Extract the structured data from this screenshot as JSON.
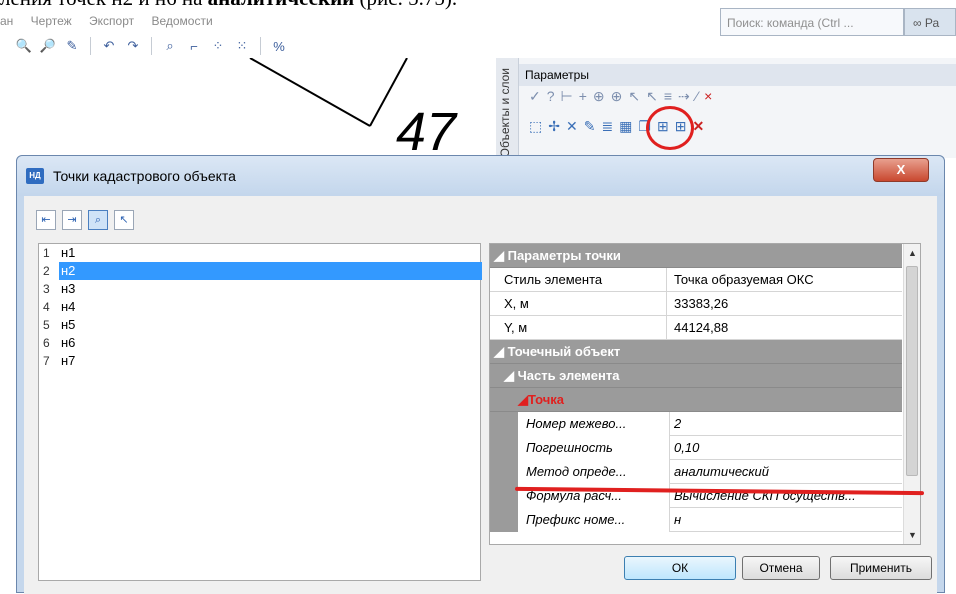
{
  "caption": {
    "pre": "ления точек н2 и н6 на ",
    "bold": "аналитический",
    "post": " (рис. 5.75)."
  },
  "menu": [
    "ан",
    "Чертеж",
    "Экспорт",
    "Ведомости"
  ],
  "search": {
    "placeholder": "Поиск: команда (Ctrl ...",
    "right_label": "Ра"
  },
  "drawing": {
    "number_label": "47"
  },
  "panel": {
    "vertical_tab": "Объекты и слои",
    "title": "Параметры"
  },
  "dialog": {
    "title": "Точки кадастрового объекта",
    "icon_text": "НД",
    "close": "X",
    "points": [
      {
        "num": "1",
        "label": "н1"
      },
      {
        "num": "2",
        "label": "н2"
      },
      {
        "num": "3",
        "label": "н3"
      },
      {
        "num": "4",
        "label": "н4"
      },
      {
        "num": "5",
        "label": "н5"
      },
      {
        "num": "6",
        "label": "н6"
      },
      {
        "num": "7",
        "label": "н7"
      }
    ],
    "selected_index": 1,
    "props": {
      "cat1": "Параметры точки",
      "style_key": "Стиль элемента",
      "style_val": "Точка образуемая ОКС",
      "x_key": "X, м",
      "x_val": "33383,26",
      "y_key": "Y, м",
      "y_val": "44124,88",
      "cat2": "Точечный объект",
      "cat3": "Часть элемента",
      "cat4": "Точка",
      "num_key": "Номер межево...",
      "num_val": "2",
      "err_key": "Погрешность",
      "err_val": "0,10",
      "method_key": "Метод опреде...",
      "method_val": "аналитический",
      "formula_key": "Формула расч...",
      "formula_val": "Вычисление СКП осуществ...",
      "prefix_key": "Префикс номе...",
      "prefix_val": "н"
    },
    "buttons": {
      "ok": "ОК",
      "cancel": "Отмена",
      "apply": "Применить"
    }
  },
  "colors": {
    "accent_red": "#e0201f",
    "selection": "#3399ff",
    "category_bg": "#9b9b9b"
  }
}
